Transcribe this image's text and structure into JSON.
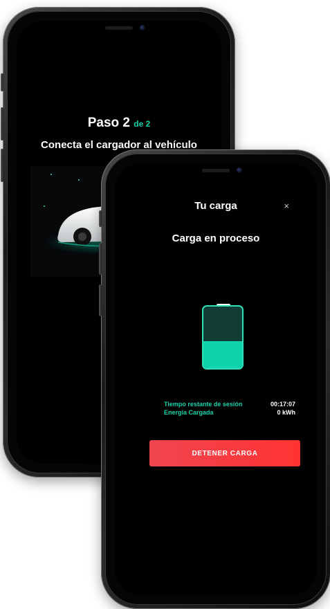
{
  "back_screen": {
    "step_label": "Paso 2",
    "step_of": "de 2",
    "subtitle": "Conecta el cargador al vehículo"
  },
  "front_screen": {
    "header_title": "Tu carga",
    "close_label": "×",
    "status_title": "Carga en proceso",
    "battery_level_fraction": 0.44,
    "stats": [
      {
        "label": "Tiempo restante de sesión",
        "value": "00:17:07"
      },
      {
        "label": "Energía Cargada",
        "value": "0 kWh"
      }
    ],
    "stop_button_label": "DETENER CARGA"
  },
  "colors": {
    "accent": "#12d3a8",
    "battery_fill": "#0ed3ab",
    "battery_empty": "#113d35",
    "stop_button": "#f03c45",
    "screen_background": "#000000"
  },
  "icons": [
    "battery-icon",
    "close-icon",
    "car-illustration"
  ]
}
